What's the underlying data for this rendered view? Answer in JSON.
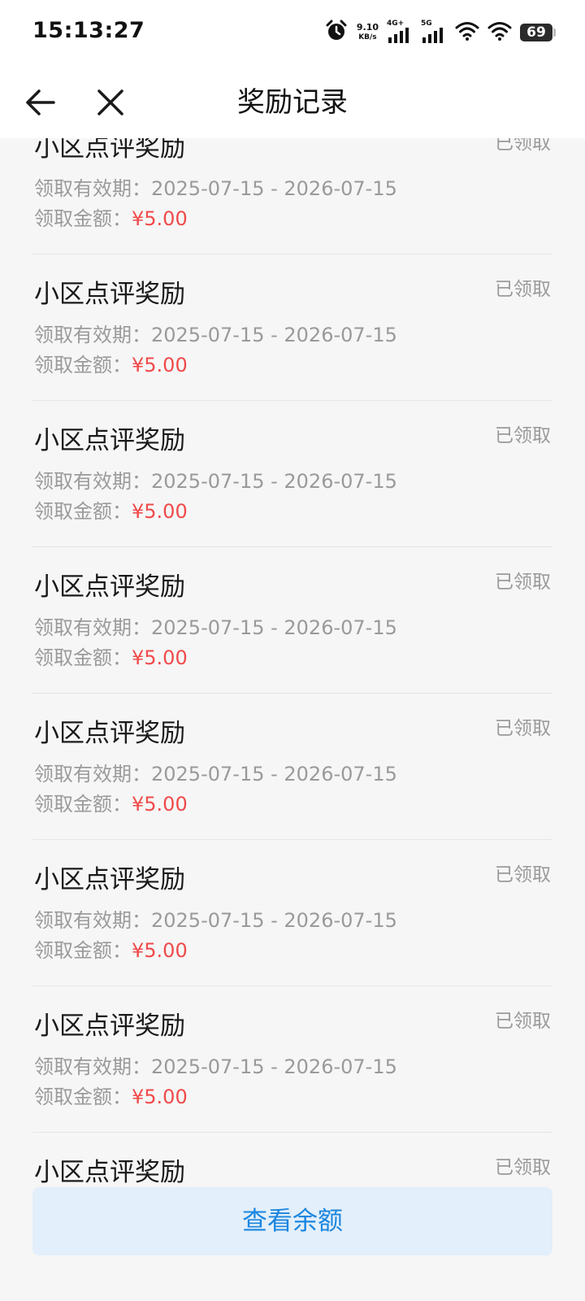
{
  "status_bar": {
    "time": "15:13:27",
    "net_speed_value": "9.10",
    "net_speed_unit": "KB/s",
    "sim1_label": "4G+",
    "sim2_label": "5G",
    "battery": "69",
    "icons": [
      "alarm-icon",
      "signal-icon",
      "signal-icon",
      "wifi-icon",
      "wifi-icon",
      "battery-icon"
    ]
  },
  "header": {
    "title": "奖励记录",
    "back_icon": "arrow-left-icon",
    "close_icon": "close-icon"
  },
  "records": [
    {
      "title": "小区点评奖励",
      "status": "已领取",
      "period_label": "领取有效期：",
      "period": "2025-07-15 - 2026-07-15",
      "amount_label": "领取金额：",
      "amount": "¥5.00"
    },
    {
      "title": "小区点评奖励",
      "status": "已领取",
      "period_label": "领取有效期：",
      "period": "2025-07-15 - 2026-07-15",
      "amount_label": "领取金额：",
      "amount": "¥5.00"
    },
    {
      "title": "小区点评奖励",
      "status": "已领取",
      "period_label": "领取有效期：",
      "period": "2025-07-15 - 2026-07-15",
      "amount_label": "领取金额：",
      "amount": "¥5.00"
    },
    {
      "title": "小区点评奖励",
      "status": "已领取",
      "period_label": "领取有效期：",
      "period": "2025-07-15 - 2026-07-15",
      "amount_label": "领取金额：",
      "amount": "¥5.00"
    },
    {
      "title": "小区点评奖励",
      "status": "已领取",
      "period_label": "领取有效期：",
      "period": "2025-07-15 - 2026-07-15",
      "amount_label": "领取金额：",
      "amount": "¥5.00"
    },
    {
      "title": "小区点评奖励",
      "status": "已领取",
      "period_label": "领取有效期：",
      "period": "2025-07-15 - 2026-07-15",
      "amount_label": "领取金额：",
      "amount": "¥5.00"
    },
    {
      "title": "小区点评奖励",
      "status": "已领取",
      "period_label": "领取有效期：",
      "period": "2025-07-15 - 2026-07-15",
      "amount_label": "领取金额：",
      "amount": "¥5.00"
    },
    {
      "title": "小区点评奖励",
      "status": "已领取"
    }
  ],
  "bottom": {
    "button_label": "查看余额"
  },
  "colors": {
    "amount": "#f04a4a",
    "button_bg": "#e3effa",
    "button_text": "#1a86e0",
    "page_bg": "#f6f6f6"
  }
}
